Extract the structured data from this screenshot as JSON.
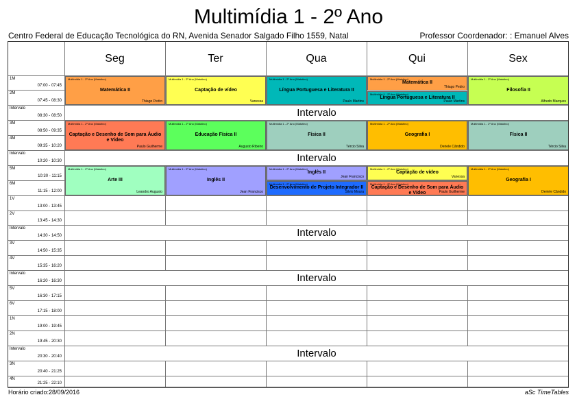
{
  "title": "Multimídia 1 - 2º Ano",
  "header_left": "Centro Federal de Educação Tecnológica do RN, Avenida Senador Salgado Filho 1559, Natal",
  "header_right": "Professor Coordenador: : Emanuel Alves",
  "footer_left": "Horário criado:28/09/2016",
  "footer_right": "aSc TimeTables",
  "days": [
    "Seg",
    "Ter",
    "Qua",
    "Qui",
    "Sex"
  ],
  "periods": [
    {
      "label": "1M",
      "time": "07:00 - 07:45"
    },
    {
      "label": "2M",
      "time": "07:45 - 08:30"
    },
    {
      "label": "Intervalo",
      "time": "08:30 - 08:50",
      "break": "Intervalo"
    },
    {
      "label": "3M",
      "time": "08:50 - 09:35"
    },
    {
      "label": "4M",
      "time": "09:35 - 10:20"
    },
    {
      "label": "Intervalo",
      "time": "10:20 - 10:30",
      "break": "Intervalo"
    },
    {
      "label": "5M",
      "time": "10:30 - 11:15"
    },
    {
      "label": "6M",
      "time": "11:15 - 12:00"
    },
    {
      "label": "1V",
      "time": "13:00 - 13:45"
    },
    {
      "label": "2V",
      "time": "13:45 - 14:30"
    },
    {
      "label": "Intervalo",
      "time": "14:30 - 14:50",
      "break": "Intervalo"
    },
    {
      "label": "3V",
      "time": "14:50 - 15:35"
    },
    {
      "label": "4V",
      "time": "15:35 - 16:20"
    },
    {
      "label": "Intervalo",
      "time": "16:20 - 16:30",
      "break": "Intervalo"
    },
    {
      "label": "5V",
      "time": "16:30 - 17:15"
    },
    {
      "label": "6V",
      "time": "17:15 - 18:00"
    },
    {
      "label": "1N",
      "time": "19:00 - 19:45"
    },
    {
      "label": "2N",
      "time": "19:45 - 20:30"
    },
    {
      "label": "Intervalo",
      "time": "20:30 - 20:40",
      "break": "Intervalo"
    },
    {
      "label": "3N",
      "time": "20:40 - 21:25"
    },
    {
      "label": "4N",
      "time": "21:25 - 22:10"
    }
  ],
  "lessons": [
    {
      "day": 0,
      "period": 0,
      "span": 2,
      "part": 0,
      "parts": 1,
      "class": "Multimídia 1 - 2º Ano (Matutino)",
      "subject": "Matemática II",
      "teacher": "Thiago Pedro",
      "color": "#ff9f46"
    },
    {
      "day": 1,
      "period": 0,
      "span": 2,
      "part": 0,
      "parts": 1,
      "class": "Multimídia 1 - 2º Ano (Matutino)",
      "subject": "Captação de vídeo",
      "teacher": "Vanessa",
      "color": "#ffff52"
    },
    {
      "day": 2,
      "period": 0,
      "span": 2,
      "part": 0,
      "parts": 1,
      "class": "Multimídia 1 - 2º Ano (Matutino)",
      "subject": "Língua Portuguesa e Literatura II",
      "teacher": "Paulo Martins",
      "color": "#00b8b8"
    },
    {
      "day": 3,
      "period": 0,
      "span": 2,
      "part": 0,
      "parts": 2,
      "class": "Multimídia 1 - 2º Ano (Matutino)",
      "subject": "Matemática II",
      "teacher": "Thiago Pedro",
      "color": "#ff9f46"
    },
    {
      "day": 3,
      "period": 0,
      "span": 2,
      "part": 1,
      "parts": 2,
      "class": "Multimídia 1 - 2º Ano (Matutino)",
      "subject": "Língua Portuguesa e Literatura II",
      "teacher": "Paulo Martins",
      "color": "#00b8b8"
    },
    {
      "day": 4,
      "period": 0,
      "span": 2,
      "part": 0,
      "parts": 1,
      "class": "Multimídia 1 - 2º Ano (Matutino)",
      "subject": "Filosofia II",
      "teacher": "Alfredo Marques",
      "color": "#c6ff52"
    },
    {
      "day": 0,
      "period": 3,
      "span": 2,
      "part": 0,
      "parts": 1,
      "class": "Multimídia 1 - 2º Ano (Matutino)",
      "subject": "Captação e Desenho de Som para Áudio e Vídeo",
      "teacher": "Paulo Guilherme",
      "color": "#ff7a55"
    },
    {
      "day": 1,
      "period": 3,
      "span": 2,
      "part": 0,
      "parts": 1,
      "class": "Multimídia 1 - 2º Ano (Matutino)",
      "subject": "Educação Física II",
      "teacher": "Augusto Ribeiro",
      "color": "#5cff5c"
    },
    {
      "day": 2,
      "period": 3,
      "span": 2,
      "part": 0,
      "parts": 1,
      "class": "Multimídia 1 - 2º Ano (Matutino)",
      "subject": "Física II",
      "teacher": "Tércio Silva",
      "color": "#9ecfbe"
    },
    {
      "day": 3,
      "period": 3,
      "span": 2,
      "part": 0,
      "parts": 1,
      "class": "Multimídia 1 - 2º Ano (Matutino)",
      "subject": "Geografia I",
      "teacher": "Deriele Cândido",
      "color": "#ffbe00"
    },
    {
      "day": 4,
      "period": 3,
      "span": 2,
      "part": 0,
      "parts": 1,
      "class": "Multimídia 1 - 2º Ano (Matutino)",
      "subject": "Física II",
      "teacher": "Tércio Silva",
      "color": "#9ecfbe"
    },
    {
      "day": 0,
      "period": 6,
      "span": 2,
      "part": 0,
      "parts": 1,
      "class": "Multimídia 1 - 2º Ano (Matutino)",
      "subject": "Arte III",
      "teacher": "Leandro Augusto",
      "color": "#a0ffc0"
    },
    {
      "day": 1,
      "period": 6,
      "span": 2,
      "part": 0,
      "parts": 1,
      "class": "Multimídia 1 - 2º Ano (Matutino)",
      "subject": "Inglês II",
      "teacher": "Jean Francisco",
      "color": "#a0a0ff"
    },
    {
      "day": 2,
      "period": 6,
      "span": 1,
      "part": 0,
      "parts": 1,
      "class": "Multimídia 1 - 2º Ano (Matutino)",
      "subject": "Inglês II",
      "teacher": "Jean Francisco",
      "color": "#a0a0ff"
    },
    {
      "day": 2,
      "period": 7,
      "span": 1,
      "part": 0,
      "parts": 1,
      "class": "Multimídia 1 - 2º Ano (Matutino)",
      "subject": "Desenvolvimento de Projeto Integrador II",
      "teacher": "Silvio Moura",
      "color": "#1e6bff"
    },
    {
      "day": 3,
      "period": 6,
      "span": 1,
      "part": 0,
      "parts": 1,
      "class": "Multimídia 1 - 2º Ano (Matutino)",
      "subject": "Captação de vídeo",
      "teacher": "Vanessa",
      "color": "#ffff52"
    },
    {
      "day": 3,
      "period": 7,
      "span": 1,
      "part": 0,
      "parts": 1,
      "class": "Multimídia 1 - 2º Ano (Matutino)",
      "subject": "Captação e Desenho de Som para Áudio e Vídeo",
      "teacher": "Paulo Guilherme",
      "color": "#ff7a55"
    },
    {
      "day": 4,
      "period": 6,
      "span": 2,
      "part": 0,
      "parts": 1,
      "class": "Multimídia 1 - 2º Ano (Matutino)",
      "subject": "Geografia I",
      "teacher": "Deriele Cândido",
      "color": "#ffbe00"
    }
  ]
}
